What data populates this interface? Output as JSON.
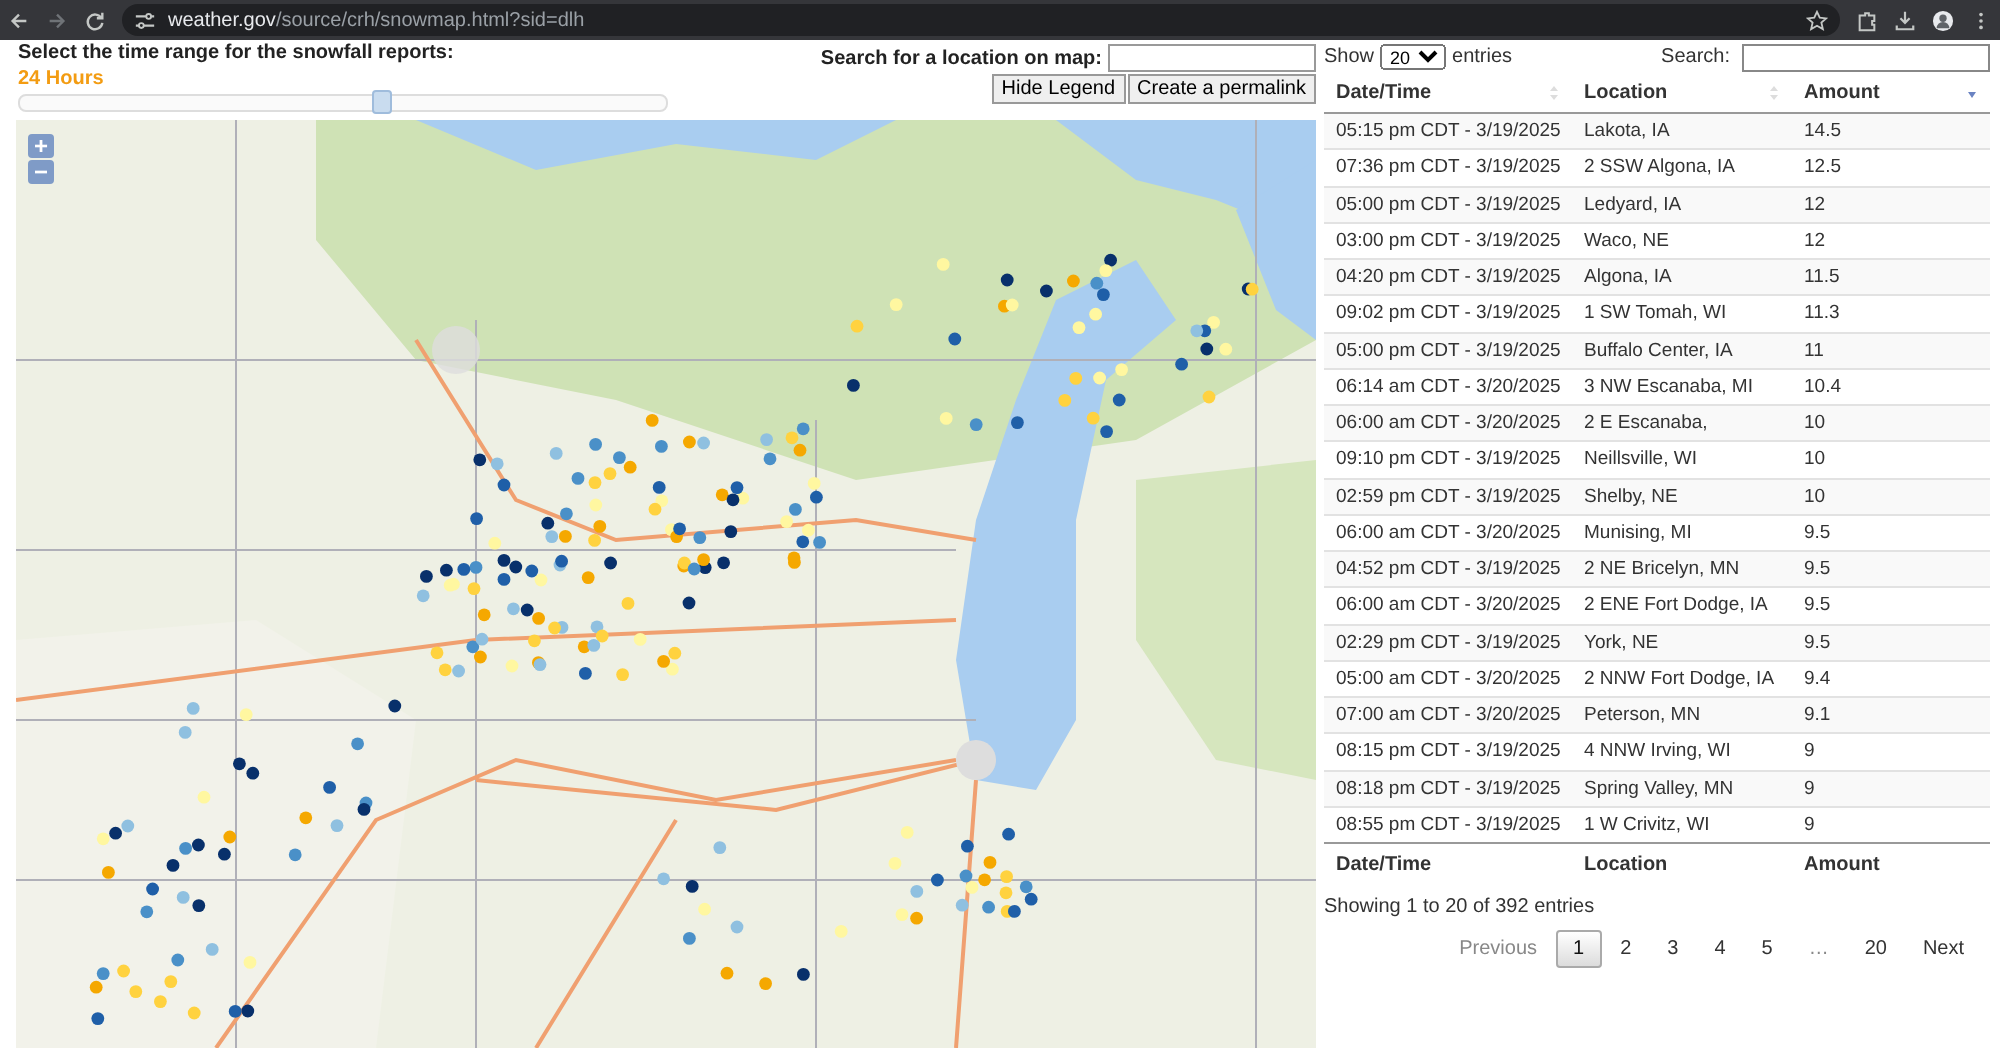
{
  "browser": {
    "url_host": "weather.gov",
    "url_path": "/source/crh/snowmap.html?sid=dlh"
  },
  "controls": {
    "time_label": "Select the time range for the snowfall reports:",
    "time_value": "24 Hours",
    "slider": {
      "level": 0.56
    },
    "search_label": "Search for a location on map:",
    "buttons": [
      "Hide Legend",
      "Create a permalink"
    ]
  },
  "map": {
    "zoom_buttons": [
      "+",
      "−"
    ]
  },
  "table": {
    "length_before": "Show",
    "length_value": "20",
    "length_after": "entries",
    "search_label": "Search:",
    "columns": [
      {
        "label": "Date/Time",
        "sorted": false
      },
      {
        "label": "Location",
        "sorted": false
      },
      {
        "label": "Amount",
        "sorted": true
      }
    ],
    "rows": [
      [
        "05:15 pm CDT - 3/19/2025",
        "Lakota, IA",
        "14.5"
      ],
      [
        "07:36 pm CDT - 3/19/2025",
        "2 SSW Algona, IA",
        "12.5"
      ],
      [
        "05:00 pm CDT - 3/19/2025",
        "Ledyard, IA",
        "12"
      ],
      [
        "03:00 pm CDT - 3/19/2025",
        "Waco, NE",
        "12"
      ],
      [
        "04:20 pm CDT - 3/19/2025",
        "Algona, IA",
        "11.5"
      ],
      [
        "09:02 pm CDT - 3/19/2025",
        "1 SW Tomah, WI",
        "11.3"
      ],
      [
        "05:00 pm CDT - 3/19/2025",
        "Buffalo Center, IA",
        "11"
      ],
      [
        "06:14 am CDT - 3/20/2025",
        "3 NW Escanaba, MI",
        "10.4"
      ],
      [
        "06:00 am CDT - 3/20/2025",
        "2 E Escanaba,",
        "10"
      ],
      [
        "09:10 pm CDT - 3/19/2025",
        "Neillsville, WI",
        "10"
      ],
      [
        "02:59 pm CDT - 3/19/2025",
        "Shelby, NE",
        "10"
      ],
      [
        "06:00 am CDT - 3/20/2025",
        "Munising, MI",
        "9.5"
      ],
      [
        "04:52 pm CDT - 3/19/2025",
        "2 NE Bricelyn, MN",
        "9.5"
      ],
      [
        "06:00 am CDT - 3/20/2025",
        "2 ENE Fort Dodge, IA",
        "9.5"
      ],
      [
        "02:29 pm CDT - 3/19/2025",
        "York, NE",
        "9.5"
      ],
      [
        "05:00 am CDT - 3/20/2025",
        "2 NNW Fort Dodge, IA",
        "9.4"
      ],
      [
        "07:00 am CDT - 3/20/2025",
        "Peterson, MN",
        "9.1"
      ],
      [
        "08:15 pm CDT - 3/19/2025",
        "4 NNW Irving, WI",
        "9"
      ],
      [
        "08:18 pm CDT - 3/19/2025",
        "Spring Valley, MN",
        "9"
      ],
      [
        "08:55 pm CDT - 3/19/2025",
        "1 W Crivitz, WI",
        "9"
      ]
    ],
    "footer_columns": [
      "Date/Time",
      "Location",
      "Amount"
    ],
    "info": "Showing 1 to 20 of 392 entries",
    "pagination": [
      {
        "label": "Previous",
        "kind": "nav",
        "disabled": true
      },
      {
        "label": "1",
        "kind": "page",
        "selected": true
      },
      {
        "label": "2",
        "kind": "page",
        "selected": false
      },
      {
        "label": "3",
        "kind": "page",
        "selected": false
      },
      {
        "label": "4",
        "kind": "page",
        "selected": false
      },
      {
        "label": "5",
        "kind": "page",
        "selected": false
      },
      {
        "label": "…",
        "kind": "gap"
      },
      {
        "label": "20",
        "kind": "page",
        "selected": false
      },
      {
        "label": "Next",
        "kind": "nav",
        "disabled": false
      }
    ]
  }
}
